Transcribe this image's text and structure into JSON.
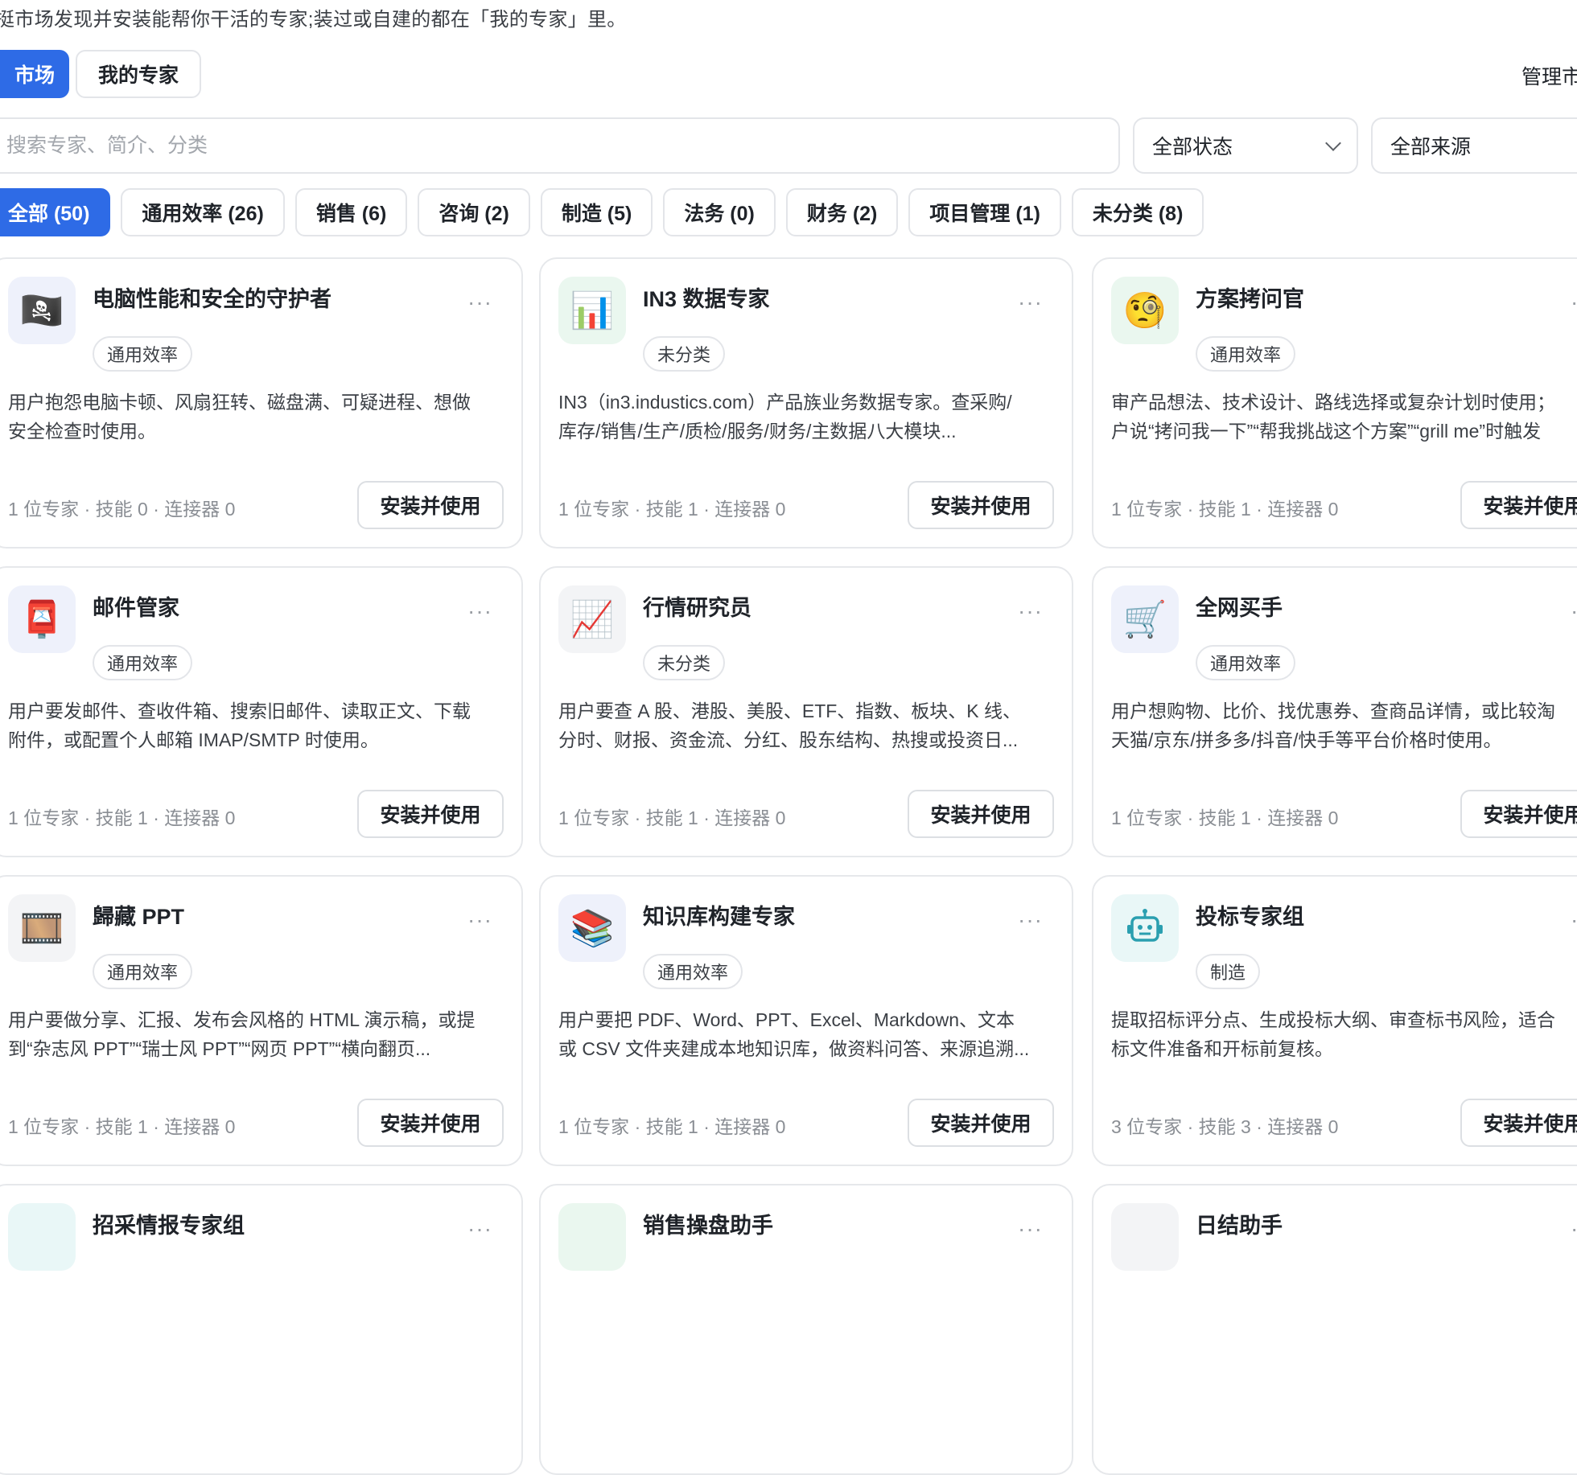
{
  "intro_text": "挺市场发现并安装能帮你干活的专家;装过或自建的都在「我的专家」里。",
  "tabs": {
    "market": "市场",
    "my_experts": "我的专家",
    "manage": "管理市"
  },
  "search": {
    "placeholder": "搜索专家、简介、分类"
  },
  "filters": {
    "status": "全部状态",
    "source": "全部来源"
  },
  "categories": [
    "全部 (50)",
    "通用效率 (26)",
    "销售 (6)",
    "咨询 (2)",
    "制造 (5)",
    "法务 (0)",
    "财务 (2)",
    "项目管理 (1)",
    "未分类 (8)"
  ],
  "install_label": "安装并使用",
  "more_label": "···",
  "cards": [
    {
      "icon": "pirate-flag-icon",
      "icon_glyph": "🏴‍☠️",
      "icon_bg": "#eef1fb",
      "title": "电脑性能和安全的守护者",
      "tag": "通用效率",
      "desc": "用户抱怨电脑卡顿、风扇狂转、磁盘满、可疑进程、想做\n安全检查时使用。",
      "meta": "1 位专家  ·  技能 0  ·  连接器 0"
    },
    {
      "icon": "bar-chart-icon",
      "icon_glyph": "📊",
      "icon_bg": "#eaf7ef",
      "title": "IN3 数据专家",
      "tag": "未分类",
      "desc": "IN3（in3.industics.com）产品族业务数据专家。查采购/\n库存/销售/生产/质检/服务/财务/主数据八大模块...",
      "meta": "1 位专家  ·  技能 1  ·  连接器 0"
    },
    {
      "icon": "monocle-face-icon",
      "icon_glyph": "🧐",
      "icon_bg": "#eaf7ef",
      "title": "方案拷问官",
      "tag": "通用效率",
      "desc": "审产品想法、技术设计、路线选择或复杂计划时使用；\n户说“拷问我一下”“帮我挑战这个方案”“grill me”时触发",
      "meta": "1 位专家  ·  技能 1  ·  连接器 0"
    },
    {
      "icon": "postbox-icon",
      "icon_glyph": "📮",
      "icon_bg": "#eef1fb",
      "title": "邮件管家",
      "tag": "通用效率",
      "desc": "用户要发邮件、查收件箱、搜索旧邮件、读取正文、下载\n附件，或配置个人邮箱 IMAP/SMTP 时使用。",
      "meta": "1 位专家  ·  技能 1  ·  连接器 0"
    },
    {
      "icon": "trend-chart-icon",
      "icon_glyph": "📈",
      "icon_bg": "#f3f4f6",
      "title": "行情研究员",
      "tag": "未分类",
      "desc": "用户要查 A 股、港股、美股、ETF、指数、板块、K 线、\n分时、财报、资金流、分红、股东结构、热搜或投资日...",
      "meta": "1 位专家  ·  技能 1  ·  连接器 0"
    },
    {
      "icon": "shopping-cart-icon",
      "icon_glyph": "🛒",
      "icon_bg": "#eef1fb",
      "title": "全网买手",
      "tag": "通用效率",
      "desc": "用户想购物、比价、找优惠券、查商品详情，或比较淘\n天猫/京东/拼多多/抖音/快手等平台价格时使用。",
      "meta": "1 位专家  ·  技能 1  ·  连接器 0"
    },
    {
      "icon": "film-strip-icon",
      "icon_glyph": "🎞️",
      "icon_bg": "#f3f4f6",
      "title": "歸藏 PPT",
      "tag": "通用效率",
      "desc": "用户要做分享、汇报、发布会风格的 HTML 演示稿，或提\n到“杂志风 PPT”“瑞士风 PPT”“网页 PPT”“横向翻页...",
      "meta": "1 位专家  ·  技能 1  ·  连接器 0"
    },
    {
      "icon": "books-icon",
      "icon_glyph": "📚",
      "icon_bg": "#eef1fb",
      "title": "知识库构建专家",
      "tag": "通用效率",
      "desc": "用户要把 PDF、Word、PPT、Excel、Markdown、文本\n或 CSV 文件夹建成本地知识库，做资料问答、来源追溯...",
      "meta": "1 位专家  ·  技能 1  ·  连接器 0"
    },
    {
      "icon": "robot-icon",
      "icon_glyph": "",
      "icon_bg": "#e9f7f7",
      "title": "投标专家组",
      "tag": "制造",
      "desc": "提取招标评分点、生成投标大纲、审查标书风险，适合\n标文件准备和开标前复核。",
      "meta": "3 位专家  ·  技能 3  ·  连接器 0"
    },
    {
      "icon": "partial-icon",
      "icon_glyph": "",
      "icon_bg": "#e9f7f7",
      "title": "招采情报专家组",
      "tag": "",
      "desc": "",
      "meta": ""
    },
    {
      "icon": "partial-icon",
      "icon_glyph": "",
      "icon_bg": "#eaf7ef",
      "title": "销售操盘助手",
      "tag": "",
      "desc": "",
      "meta": ""
    },
    {
      "icon": "partial-icon",
      "icon_glyph": "",
      "icon_bg": "#f3f4f6",
      "title": "日结助手",
      "tag": "",
      "desc": "",
      "meta": ""
    }
  ]
}
